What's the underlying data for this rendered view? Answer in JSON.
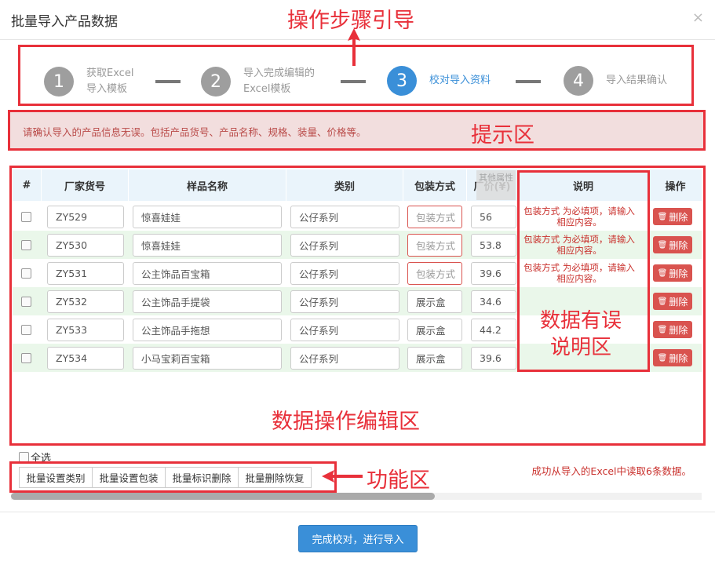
{
  "modal": {
    "title": "批量导入产品数据",
    "close": "×"
  },
  "annotations": {
    "steps": "操作步骤引导",
    "tips": "提示区",
    "error_area_line1": "数据有误",
    "error_area_line2": "说明区",
    "edit_area": "数据操作编辑区",
    "function_area": "功能区"
  },
  "steps": [
    {
      "num": "1",
      "line1": "获取Excel",
      "line2": "导入模板"
    },
    {
      "num": "2",
      "line1": "导入完成编辑的",
      "line2": "Excel模板"
    },
    {
      "num": "3",
      "line1": "校对导入资料",
      "line2": "",
      "active": true
    },
    {
      "num": "4",
      "line1": "导入结果确认",
      "line2": ""
    }
  ],
  "tips": "请确认导入的产品信息无误。包括产品货号、产品名称、规格、装量、价格等。",
  "table": {
    "headers": {
      "idx": "#",
      "code": "厂家货号",
      "name": "样品名称",
      "category": "类别",
      "pack": "包装方式",
      "price": "厂价(¥)",
      "note": "说明",
      "action": "操作"
    },
    "other_tag": "其他属性",
    "rows": [
      {
        "code": "ZY529",
        "name": "惊喜娃娃",
        "category": "公仔系列",
        "pack": "包装方式",
        "pack_error": true,
        "price": "56",
        "note_line1": "包装方式 为必填项，请输入",
        "note_line2": "相应内容。"
      },
      {
        "code": "ZY530",
        "name": "惊喜娃娃",
        "category": "公仔系列",
        "pack": "包装方式",
        "pack_error": true,
        "price": "53.8",
        "note_line1": "包装方式 为必填项，请输入",
        "note_line2": "相应内容。"
      },
      {
        "code": "ZY531",
        "name": "公主饰品百宝箱",
        "category": "公仔系列",
        "pack": "包装方式",
        "pack_error": true,
        "price": "39.6",
        "note_line1": "包装方式 为必填项，请输入",
        "note_line2": "相应内容。"
      },
      {
        "code": "ZY532",
        "name": "公主饰品手提袋",
        "category": "公仔系列",
        "pack": "展示盒",
        "pack_error": false,
        "price": "34.6",
        "note_line1": "",
        "note_line2": ""
      },
      {
        "code": "ZY533",
        "name": "公主饰品手拖想",
        "category": "公仔系列",
        "pack": "展示盒",
        "pack_error": false,
        "price": "44.2",
        "note_line1": "",
        "note_line2": ""
      },
      {
        "code": "ZY534",
        "name": "小马宝莉百宝箱",
        "category": "公仔系列",
        "pack": "展示盒",
        "pack_error": false,
        "price": "39.6",
        "note_line1": "",
        "note_line2": ""
      }
    ],
    "delete_label": "删除"
  },
  "bottom": {
    "select_all": "全选",
    "buttons": [
      "批量设置类别",
      "批量设置包装",
      "批量标识删除",
      "批量删除恢复"
    ],
    "success": "成功从导入的Excel中读取6条数据。",
    "primary": "完成校对，进行导入"
  },
  "colors": {
    "accent": "#3a8fd8",
    "annotation": "#e8303a",
    "error": "#c9302c",
    "delete": "#d9534f"
  }
}
